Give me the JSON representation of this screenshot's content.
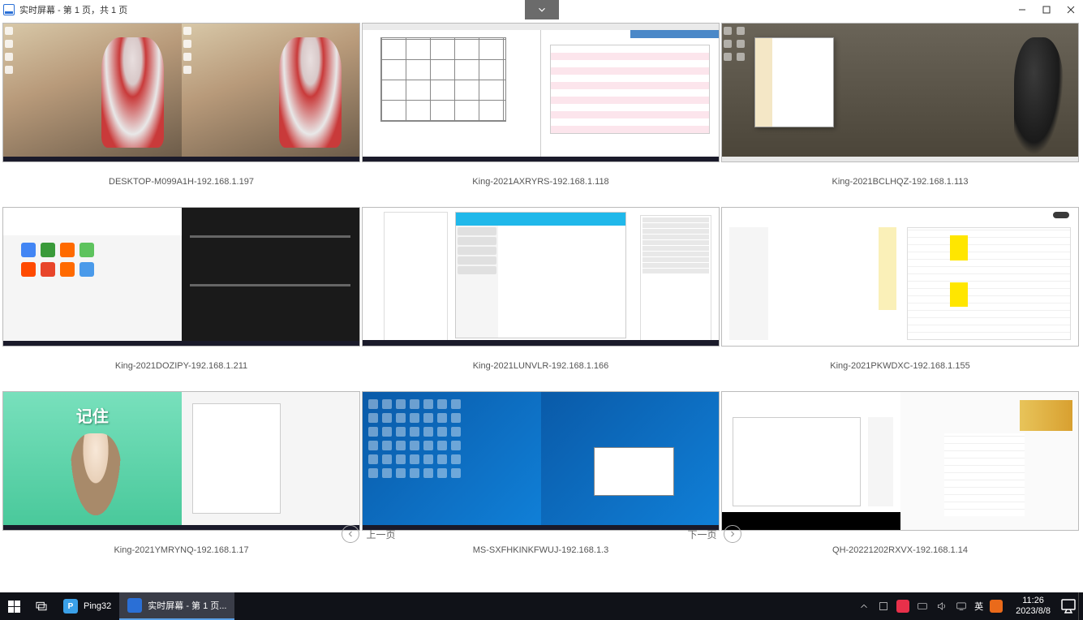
{
  "window": {
    "title": "实时屏幕 - 第 1 页，共 1 页"
  },
  "pager": {
    "prev": "上一页",
    "next": "下一页"
  },
  "thumbnails": [
    {
      "caption": "DESKTOP-M099A1H-192.168.1.197"
    },
    {
      "caption": "King-2021AXRYRS-192.168.1.118"
    },
    {
      "caption": "King-2021BCLHQZ-192.168.1.113"
    },
    {
      "caption": "King-2021DOZIPY-192.168.1.211"
    },
    {
      "caption": "King-2021LUNVLR-192.168.1.166"
    },
    {
      "caption": "King-2021PKWDXC-192.168.1.155"
    },
    {
      "caption": "King-2021YMRYNQ-192.168.1.17"
    },
    {
      "caption": "MS-SXFHKINKFWUJ-192.168.1.3"
    },
    {
      "caption": "QH-20221202RXVX-192.168.1.14"
    }
  ],
  "game_overlay": {
    "title": "记住"
  },
  "taskbar": {
    "apps": [
      {
        "label": "Ping32",
        "icon_bg": "#3aa0e8",
        "icon_text": "P",
        "active": false
      },
      {
        "label": "实时屏幕 - 第 1 页...",
        "icon_bg": "#2a6fd6",
        "icon_text": "",
        "active": true
      }
    ],
    "ime_lang": "英",
    "time": "11:26",
    "date": "2023/8/8"
  }
}
